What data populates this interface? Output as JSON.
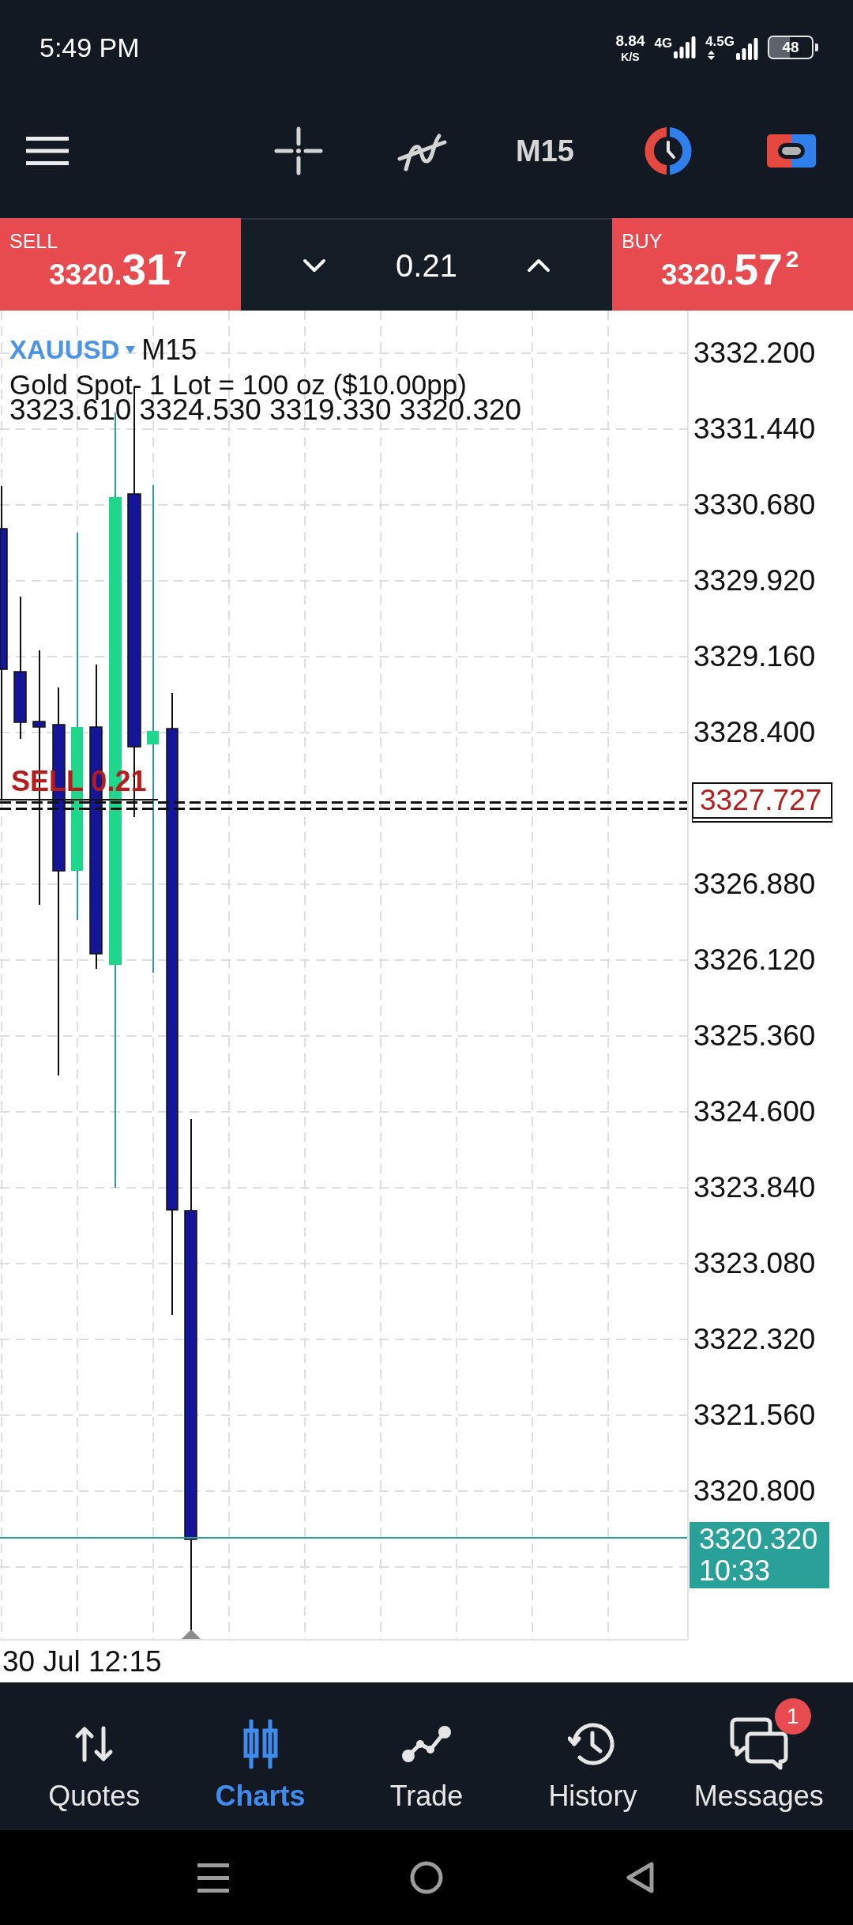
{
  "status_bar": {
    "time": "5:49 PM",
    "speed": "8.84",
    "speed_unit": "K/S",
    "network_1": "4G",
    "network_2": "4.5G",
    "battery": "48"
  },
  "toolbar": {
    "timeframe": "M15"
  },
  "trade_bar": {
    "sell": {
      "label": "SELL",
      "price_small": "3320.",
      "price_large": "31",
      "price_raised": "7"
    },
    "volume": "0.21",
    "buy": {
      "label": "BUY",
      "price_small": "3320.",
      "price_large": "57",
      "price_raised": "2"
    }
  },
  "chart": {
    "symbol": "XAUUSD",
    "timeframe": "M15",
    "description": "Gold Spot- 1 Lot = 100 oz ($10.00pp)",
    "ohlc": "3323.610 3324.530 3319.330 3320.320",
    "order_label": "SELL 0.21",
    "price_axis": [
      {
        "kind": "tick",
        "label": "3332.200"
      },
      {
        "kind": "tick",
        "label": "3331.440"
      },
      {
        "kind": "tick",
        "label": "3330.680"
      },
      {
        "kind": "tick",
        "label": "3329.920"
      },
      {
        "kind": "tick",
        "label": "3329.160"
      },
      {
        "kind": "tick",
        "label": "3328.400"
      },
      {
        "kind": "order",
        "label": "3327.727"
      },
      {
        "kind": "tick",
        "label": "3326.880"
      },
      {
        "kind": "tick",
        "label": "3326.120"
      },
      {
        "kind": "tick",
        "label": "3325.360"
      },
      {
        "kind": "tick",
        "label": "3324.600"
      },
      {
        "kind": "tick",
        "label": "3323.840"
      },
      {
        "kind": "tick",
        "label": "3323.080"
      },
      {
        "kind": "tick",
        "label": "3322.320"
      },
      {
        "kind": "tick",
        "label": "3321.560"
      },
      {
        "kind": "tick",
        "label": "3320.800"
      },
      {
        "kind": "current",
        "label": "3320.320",
        "time": "10:33"
      }
    ],
    "time_label": "30 Jul 12:15"
  },
  "bottom_nav": [
    {
      "label": "Quotes",
      "selected": false
    },
    {
      "label": "Charts",
      "selected": true
    },
    {
      "label": "Trade",
      "selected": false
    },
    {
      "label": "History",
      "selected": false
    },
    {
      "label": "Messages",
      "selected": false,
      "badge": "1"
    }
  ]
}
